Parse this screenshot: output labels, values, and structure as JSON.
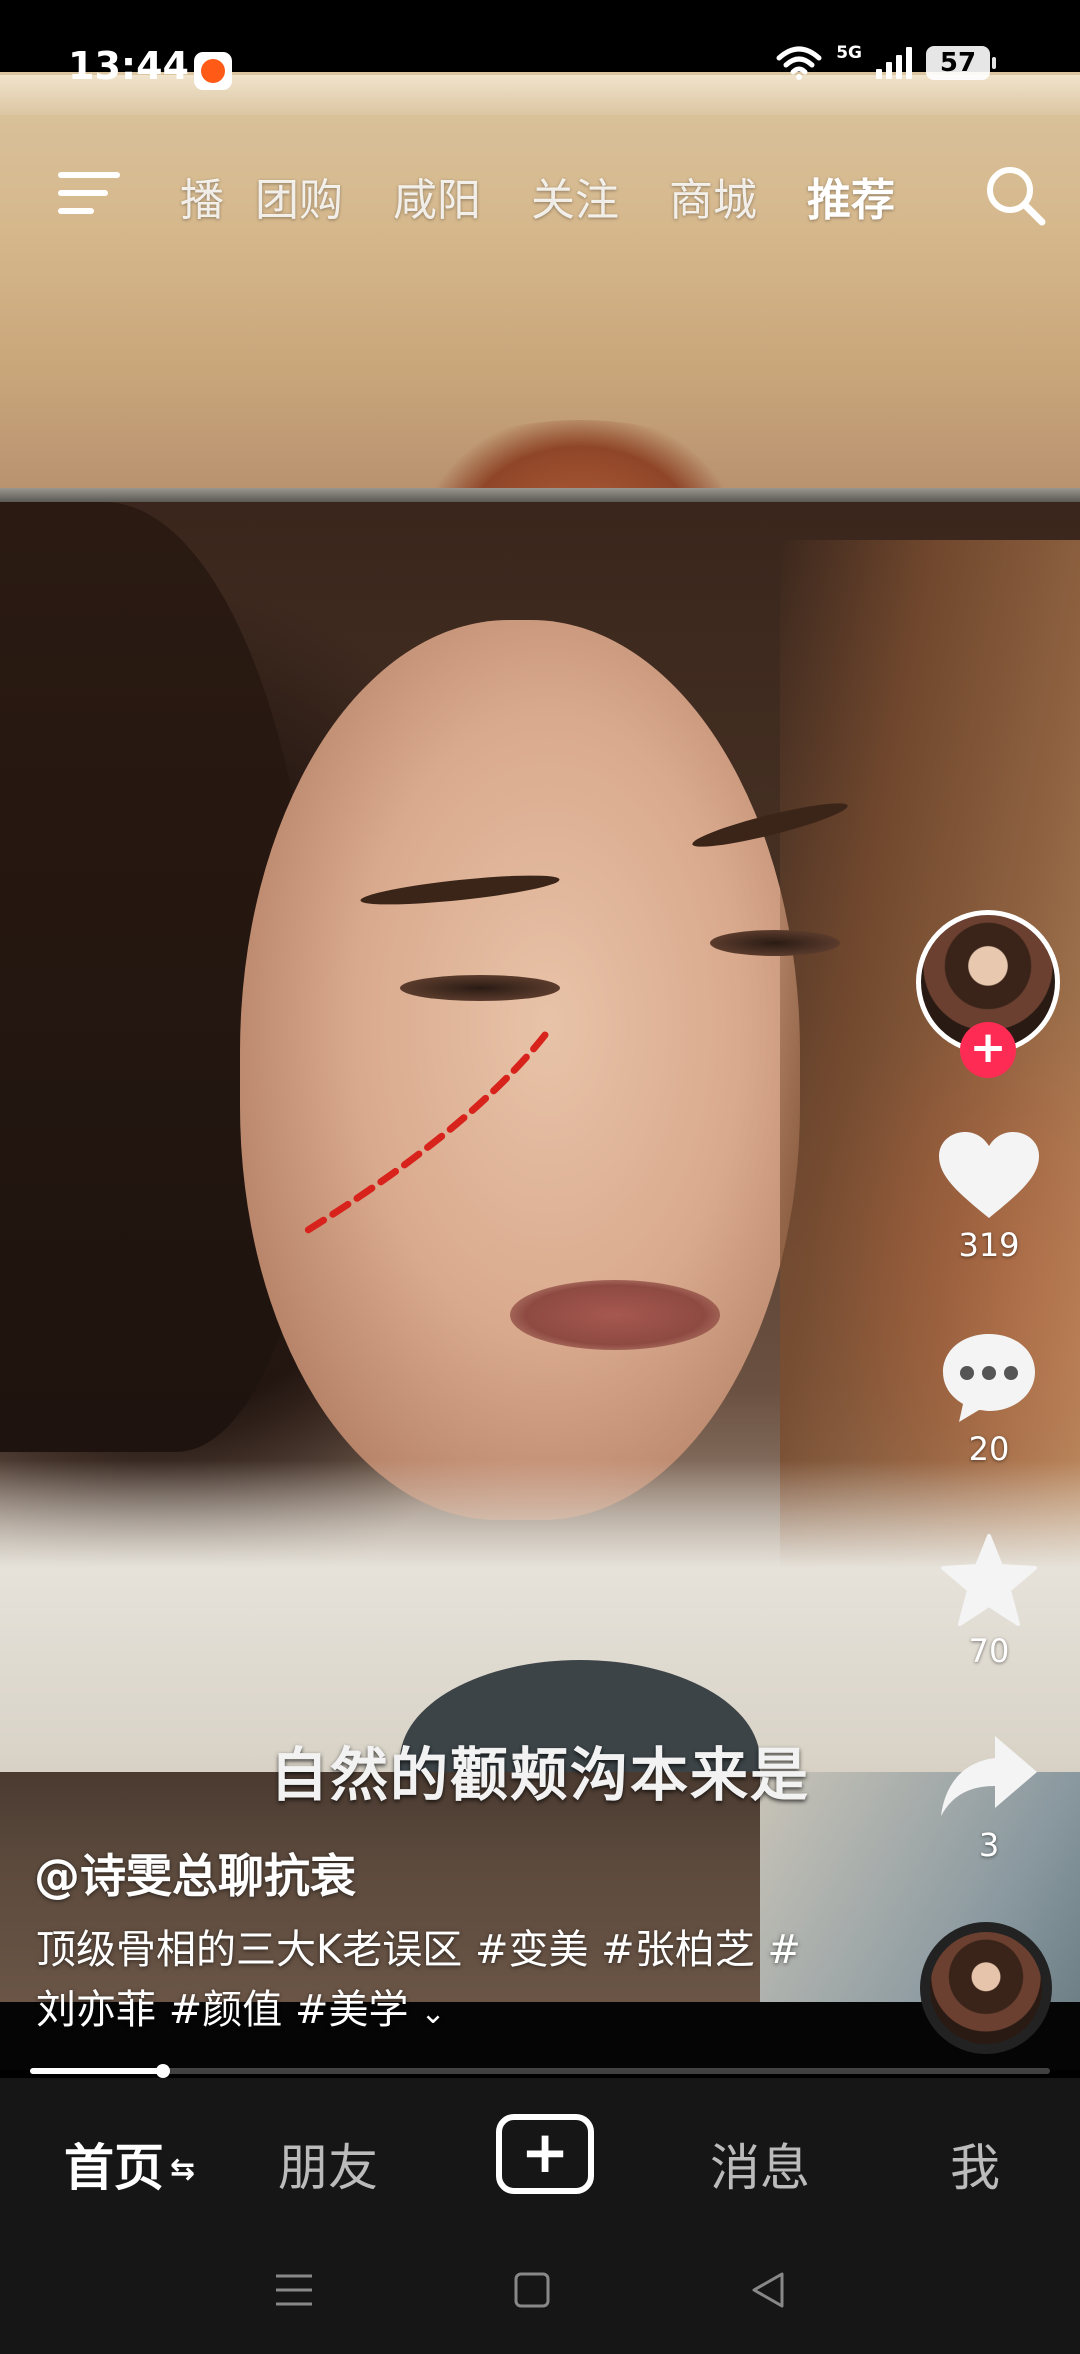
{
  "status_bar": {
    "time": "13:44",
    "network": "5G",
    "battery": "57",
    "icons": [
      "app-notification-icon",
      "wifi-icon",
      "signal-icon",
      "battery-icon"
    ]
  },
  "top_tabs": {
    "items": [
      {
        "label": "播"
      },
      {
        "label": "团购"
      },
      {
        "label": "咸阳"
      },
      {
        "label": "关注"
      },
      {
        "label": "商城"
      },
      {
        "label": "推荐",
        "active": true
      }
    ],
    "icons": [
      "menu-icon",
      "search-icon"
    ]
  },
  "video": {
    "subtitle": "自然的颧颊沟本来是"
  },
  "actions": {
    "likes": "319",
    "comments": "20",
    "favorites": "70",
    "shares": "3",
    "follow_symbol": "+"
  },
  "caption": {
    "author": "@诗雯总聊抗衰",
    "description": "顶级骨相的三大K老误区 #变美 #张柏芝 #刘亦菲 #颜值 #美学"
  },
  "playback": {
    "progress": 0.13
  },
  "bottom_nav": {
    "home": "首页",
    "home_swap": "⇆",
    "friends": "朋友",
    "create": "+",
    "messages": "消息",
    "me": "我"
  },
  "colors": {
    "accent": "#fe2c55",
    "bar_bg": "#161616",
    "cheek_line": "#d8231c"
  }
}
